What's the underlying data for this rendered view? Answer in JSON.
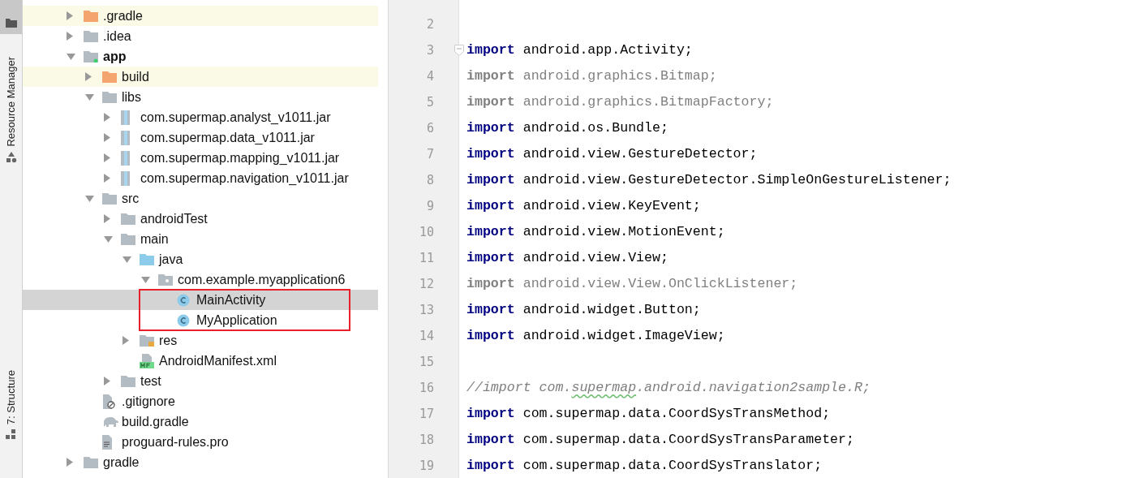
{
  "tool_strip": [
    {
      "selected": true
    },
    {
      "label": "Resource Manager",
      "selected": false
    },
    {
      "label": "7: Structure",
      "selected": false
    }
  ],
  "project_tree": [
    {
      "name": ".gradle",
      "kind": "folder-excluded",
      "expanded": false,
      "highlighted": true
    },
    {
      "name": ".idea",
      "kind": "folder",
      "expanded": false
    },
    {
      "name": "app",
      "kind": "module",
      "expanded": true,
      "bold": true,
      "children": [
        {
          "name": "build",
          "kind": "folder-excluded",
          "expanded": false,
          "highlighted": true
        },
        {
          "name": "libs",
          "kind": "folder",
          "expanded": true,
          "children": [
            {
              "name": "com.supermap.analyst_v1011.jar",
              "kind": "jar",
              "expanded": false
            },
            {
              "name": "com.supermap.data_v1011.jar",
              "kind": "jar",
              "expanded": false
            },
            {
              "name": "com.supermap.mapping_v1011.jar",
              "kind": "jar",
              "expanded": false
            },
            {
              "name": "com.supermap.navigation_v1011.jar",
              "kind": "jar",
              "expanded": false
            }
          ]
        },
        {
          "name": "src",
          "kind": "folder",
          "expanded": true,
          "children": [
            {
              "name": "androidTest",
              "kind": "folder",
              "expanded": false
            },
            {
              "name": "main",
              "kind": "folder",
              "expanded": true,
              "children": [
                {
                  "name": "java",
                  "kind": "source-folder",
                  "expanded": true,
                  "children": [
                    {
                      "name": "com.example.myapplication6",
                      "kind": "package",
                      "expanded": true,
                      "outlined_children": true,
                      "children": [
                        {
                          "name": "MainActivity",
                          "kind": "class",
                          "selected": true
                        },
                        {
                          "name": "MyApplication",
                          "kind": "class",
                          "selected": false
                        }
                      ]
                    }
                  ]
                },
                {
                  "name": "res",
                  "kind": "resource-folder",
                  "expanded": false
                },
                {
                  "name": "AndroidManifest.xml",
                  "kind": "manifest"
                }
              ]
            },
            {
              "name": "test",
              "kind": "folder",
              "expanded": false
            }
          ]
        },
        {
          "name": ".gitignore",
          "kind": "ignore-file"
        },
        {
          "name": "build.gradle",
          "kind": "gradle-file"
        },
        {
          "name": "proguard-rules.pro",
          "kind": "text-file"
        }
      ]
    },
    {
      "name": "gradle",
      "kind": "folder",
      "expanded": false
    }
  ],
  "editor": {
    "lines": [
      {
        "number": "2",
        "kind": "blank"
      },
      {
        "number": "3",
        "kind": "code",
        "keyword": "import",
        "text": "android.app.Activity;",
        "fold": true
      },
      {
        "number": "4",
        "kind": "unused",
        "keyword": "import",
        "text": "android.graphics.Bitmap;"
      },
      {
        "number": "5",
        "kind": "unused",
        "keyword": "import",
        "text": "android.graphics.BitmapFactory;"
      },
      {
        "number": "6",
        "kind": "code",
        "keyword": "import",
        "text": "android.os.Bundle;"
      },
      {
        "number": "7",
        "kind": "code",
        "keyword": "import",
        "text": "android.view.GestureDetector;"
      },
      {
        "number": "8",
        "kind": "code",
        "keyword": "import",
        "text": "android.view.GestureDetector.SimpleOnGestureListener;"
      },
      {
        "number": "9",
        "kind": "code",
        "keyword": "import",
        "text": "android.view.KeyEvent;"
      },
      {
        "number": "10",
        "kind": "code",
        "keyword": "import",
        "text": "android.view.MotionEvent;"
      },
      {
        "number": "11",
        "kind": "code",
        "keyword": "import",
        "text": "android.view.View;"
      },
      {
        "number": "12",
        "kind": "unused",
        "keyword": "import",
        "text": "android.view.View.OnClickListener;"
      },
      {
        "number": "13",
        "kind": "code",
        "keyword": "import",
        "text": "android.widget.Button;"
      },
      {
        "number": "14",
        "kind": "code",
        "keyword": "import",
        "text": "android.widget.ImageView;"
      },
      {
        "number": "15",
        "kind": "blank"
      },
      {
        "number": "16",
        "kind": "comment",
        "segments": [
          {
            "text": "//import com.",
            "typo": false
          },
          {
            "text": "supermap",
            "typo": true
          },
          {
            "text": ".android.navigation2sample.R;",
            "typo": false
          }
        ]
      },
      {
        "number": "17",
        "kind": "code",
        "keyword": "import",
        "text": "com.supermap.data.CoordSysTransMethod;"
      },
      {
        "number": "18",
        "kind": "code",
        "keyword": "import",
        "text": "com.supermap.data.CoordSysTransParameter;"
      },
      {
        "number": "19",
        "kind": "code",
        "keyword": "import",
        "text": "com.supermap.data.CoordSysTranslator;"
      }
    ]
  }
}
